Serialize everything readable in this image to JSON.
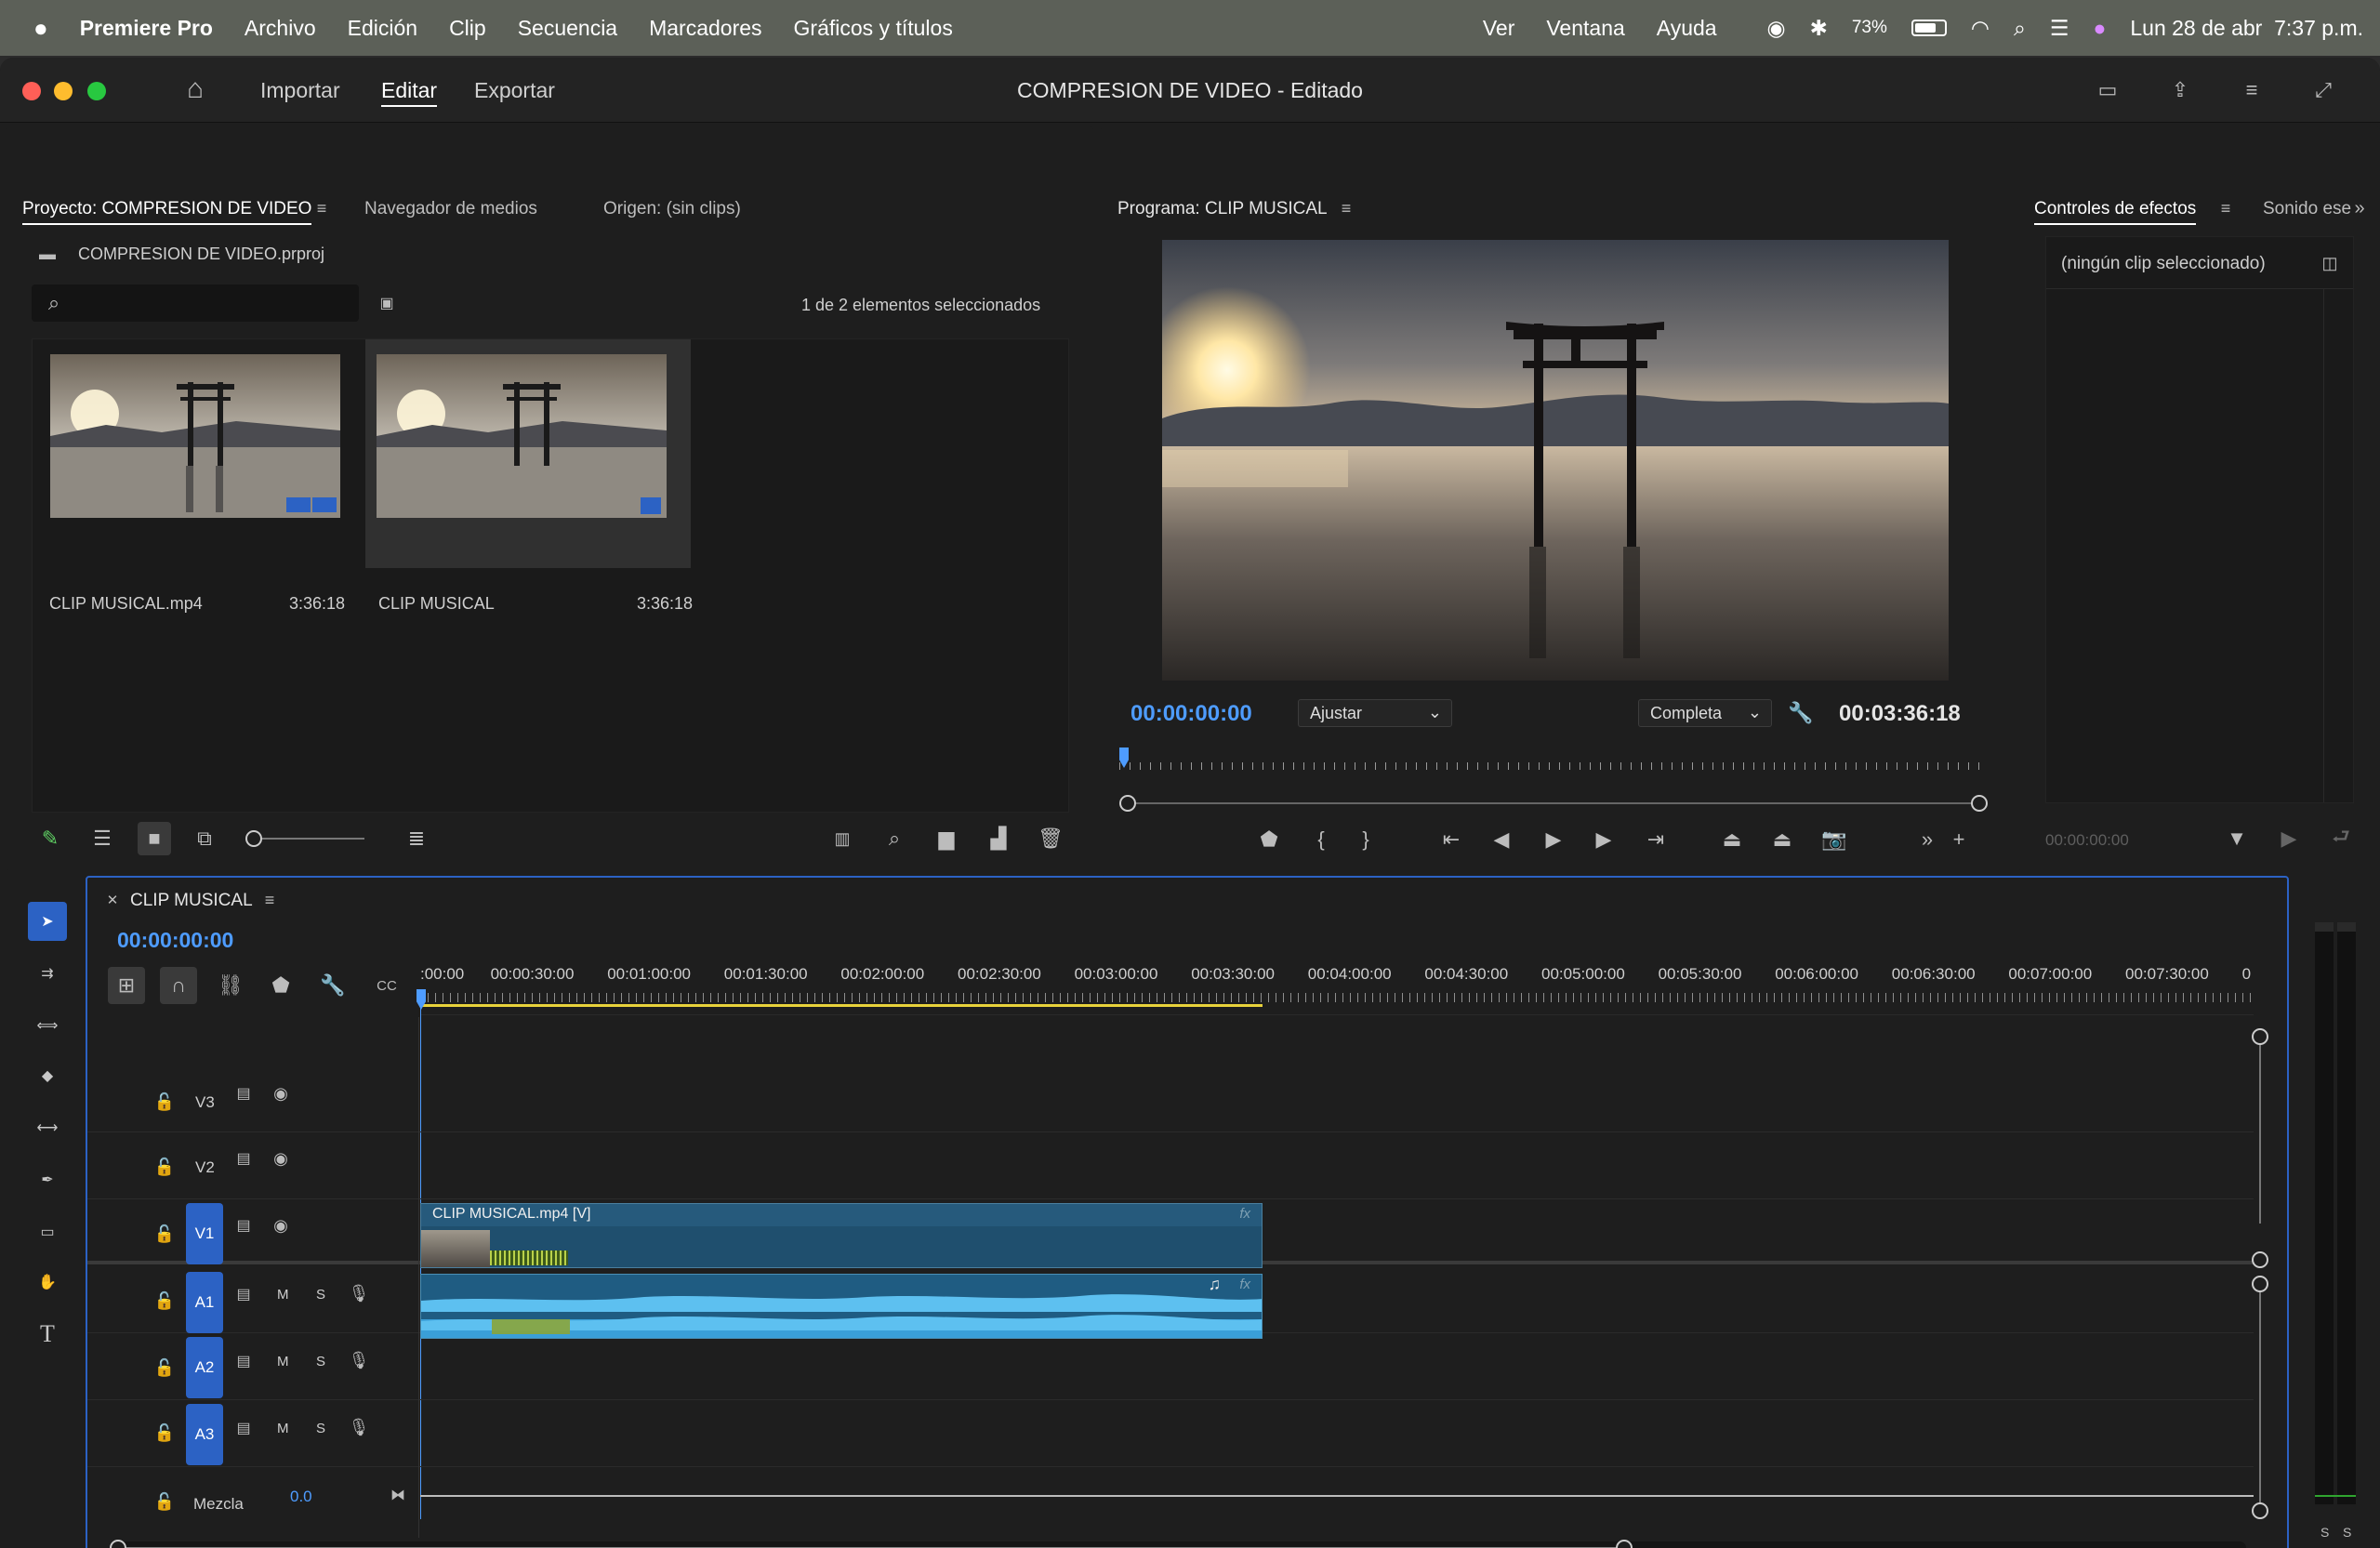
{
  "menubar": {
    "app": "Premiere Pro",
    "items": [
      "Archivo",
      "Edición",
      "Clip",
      "Secuencia",
      "Marcadores",
      "Gráficos y títulos",
      "Ver",
      "Ventana",
      "Ayuda"
    ],
    "battery": "73%",
    "datetime": "Lun 28 de abr  7:37 p.m."
  },
  "window": {
    "workspaces": [
      "Importar",
      "Editar",
      "Exportar"
    ],
    "active_workspace": "Editar",
    "doc_title": "COMPRESION DE VIDEO - Editado"
  },
  "project": {
    "tabs": [
      "Proyecto: COMPRESION DE VIDEO",
      "Navegador de medios",
      "Origen: (sin clips)"
    ],
    "file": "COMPRESION DE VIDEO.prproj",
    "selection": "1 de 2 elementos seleccionados",
    "items": [
      {
        "name": "CLIP MUSICAL.mp4",
        "duration": "3:36:18"
      },
      {
        "name": "CLIP MUSICAL",
        "duration": "3:36:18"
      }
    ]
  },
  "program": {
    "tab": "Programa: CLIP MUSICAL",
    "timecode": "00:00:00:00",
    "zoom": "Ajustar",
    "quality": "Completa",
    "duration": "00:03:36:18"
  },
  "effects": {
    "tabs": [
      "Controles de efectos",
      "Sonido ese"
    ],
    "empty": "(ningún clip seleccionado)",
    "timecode": "00:00:00:00"
  },
  "timeline": {
    "tab": "CLIP MUSICAL",
    "timecode": "00:00:00:00",
    "ruler": [
      ":00:00",
      "00:00:30:00",
      "00:01:00:00",
      "00:01:30:00",
      "00:02:00:00",
      "00:02:30:00",
      "00:03:00:00",
      "00:03:30:00",
      "00:04:00:00",
      "00:04:30:00",
      "00:05:00:00",
      "00:05:30:00",
      "00:06:00:00",
      "00:06:30:00",
      "00:07:00:00",
      "00:07:30:00",
      "0"
    ],
    "video_tracks": [
      "V3",
      "V2",
      "V1"
    ],
    "audio_tracks": [
      "A1",
      "A2",
      "A3"
    ],
    "track_buttons": {
      "mute": "M",
      "solo": "S"
    },
    "mix_label": "Mezcla",
    "mix_value": "0.0",
    "clip_video": "CLIP MUSICAL.mp4 [V]",
    "fx": "fx",
    "meter_labels": [
      "S",
      "S"
    ]
  },
  "colors": {
    "accent": "#2c62c4",
    "timecode_blue": "#4e9cff",
    "clip_video": "#1f4f6e",
    "clip_audio": "#2a8fbf",
    "workarea": "#e8d23b"
  }
}
